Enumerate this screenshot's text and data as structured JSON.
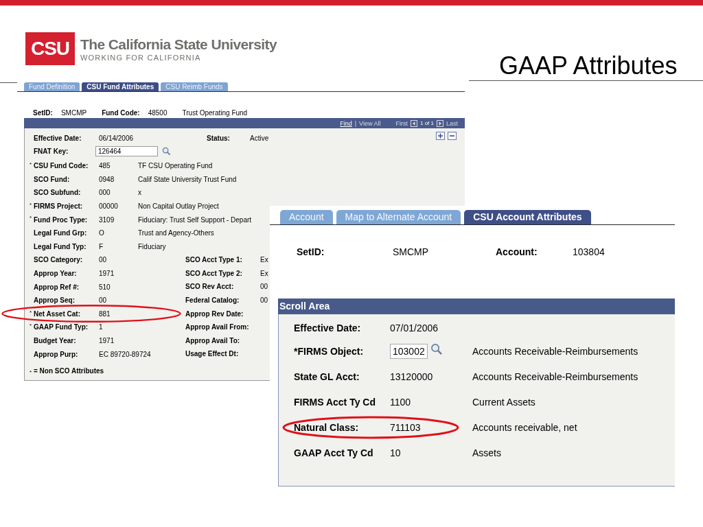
{
  "header": {
    "logo_mark": "CSU",
    "logo_title": "The California State University",
    "logo_tagline": "WORKING FOR CALIFORNIA",
    "slide_title": "GAAP Attributes"
  },
  "fund_screen": {
    "tabs": [
      {
        "label": "Fund Definition",
        "selected": false
      },
      {
        "label": "CSU Fund Attributes",
        "selected": true
      },
      {
        "label": "CSU Reimb Funds",
        "selected": false
      }
    ],
    "key_fields": [
      {
        "label": "SetID:",
        "value": "SMCMP"
      },
      {
        "label": "Fund Code:",
        "value": "48500",
        "description": "Trust Operating Fund"
      }
    ],
    "grid_bar": {
      "find": "Find",
      "separator": "|",
      "view_all": "View All",
      "first": "First",
      "counter": "1 of 1",
      "last": "Last"
    },
    "effective_date": {
      "label": "Effective Date:",
      "value": "06/14/2006"
    },
    "status": {
      "label": "Status:",
      "value": "Active"
    },
    "fnat_key": {
      "label": "FNAT Key:",
      "value": "126464"
    },
    "left_rows": [
      {
        "mark": "*",
        "label": "CSU Fund Code:",
        "value": "485",
        "description": "TF CSU Operating Fund",
        "circled": false
      },
      {
        "label": "SCO Fund:",
        "value": "0948",
        "description": "Calif State University Trust Fund",
        "circled": false
      },
      {
        "label": "SCO Subfund:",
        "value": "000",
        "description": "x",
        "circled": false
      },
      {
        "mark": "*",
        "label": "FIRMS Project:",
        "value": "00000",
        "description": "Non Capital Outlay Project",
        "circled": false
      },
      {
        "mark": "*",
        "label": "Fund Proc Type:",
        "value": "3109",
        "description": "Fiduciary: Trust Self Support - Depart",
        "circled": false
      },
      {
        "label": "Legal Fund Grp:",
        "value": "O",
        "description": "Trust and Agency-Others",
        "circled": false
      },
      {
        "label": "Legal Fund Typ:",
        "value": "F",
        "description": "Fiduciary",
        "circled": false
      },
      {
        "label": "SCO Category:",
        "value": "00",
        "circled": false
      },
      {
        "label": "Approp Year:",
        "value": "1971",
        "circled": false
      },
      {
        "label": "Approp Ref #:",
        "value": "510",
        "circled": false
      },
      {
        "label": "Approp Seq:",
        "value": "00",
        "circled": false
      },
      {
        "mark": "*",
        "label": "Net Asset Cat:",
        "value": "881",
        "circled": true
      },
      {
        "mark": "*",
        "label": "GAAP Fund Typ:",
        "value": "1",
        "circled": false
      },
      {
        "label": "Budget Year:",
        "value": "1971",
        "circled": false
      },
      {
        "label": "Approp Purp:",
        "value": "EC 89720-89724",
        "circled": false
      }
    ],
    "right_rows": [
      {
        "label": "SCO Acct Type 1:",
        "value": "Ex"
      },
      {
        "label": "SCO Acct Type 2:",
        "value": "Ex"
      },
      {
        "label": "SCO Rev Acct:",
        "value": "00"
      },
      {
        "label": "Federal Catalog:",
        "value": "00"
      },
      {
        "label": "Approp Rev Date:"
      },
      {
        "label": "Approp Avail From:"
      },
      {
        "label": "Approp Avail To:"
      },
      {
        "label": "Usage Effect Dt:"
      }
    ],
    "footnote": {
      "mark": "*",
      "text": "= Non SCO Attributes"
    }
  },
  "account_screen": {
    "tabs": [
      {
        "label": "Account",
        "selected": false
      },
      {
        "label": "Map to Alternate Account",
        "selected": false
      },
      {
        "label": "CSU Account Attributes",
        "selected": true
      }
    ],
    "key_fields": [
      {
        "label": "SetID:",
        "value": "SMCMP"
      },
      {
        "label": "Account:",
        "value": "103804"
      }
    ],
    "scroll_area": {
      "title": "Scroll Area",
      "rows": [
        {
          "kind": "text",
          "label": "Effective Date:",
          "value": "07/01/2006",
          "circled": false
        },
        {
          "kind": "field",
          "label": "*FIRMS Object:",
          "value": "103002",
          "description": "Accounts Receivable-Reimbursements",
          "circled": false
        },
        {
          "kind": "text",
          "label": "State GL Acct:",
          "value": "13120000",
          "description": "Accounts Receivable-Reimbursements",
          "circled": false
        },
        {
          "kind": "text",
          "label": "FIRMS Acct Ty Cd",
          "value": "1100",
          "description": "Current Assets",
          "circled": false
        },
        {
          "kind": "text",
          "label": "Natural Class:",
          "value": "711103",
          "description": "Accounts receivable, net",
          "circled": true
        },
        {
          "kind": "text",
          "label": "GAAP Acct Ty Cd",
          "value": "10",
          "description": "Assets",
          "circled": false
        }
      ]
    }
  }
}
